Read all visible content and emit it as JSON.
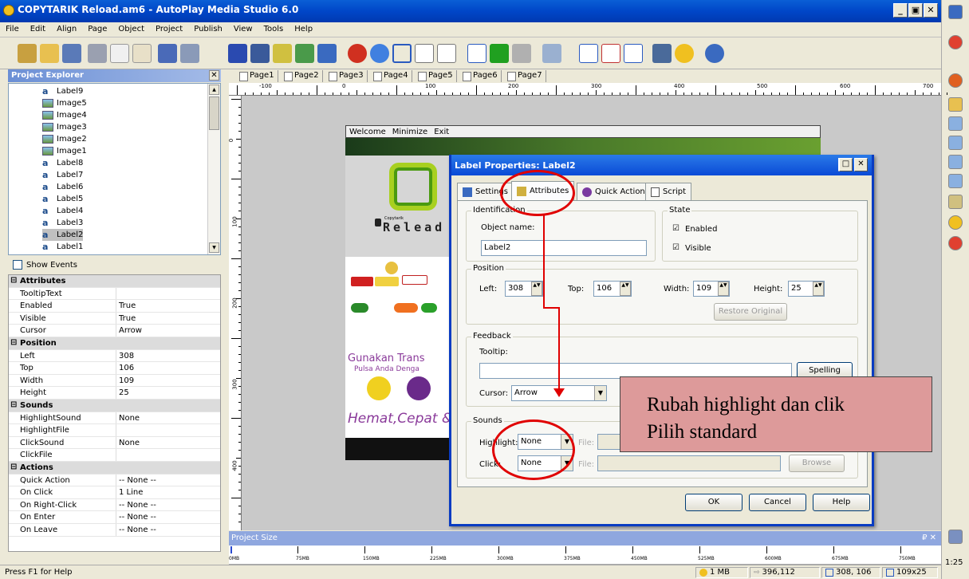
{
  "window": {
    "title": "COPYTARIK Reload.am6 - AutoPlay Media Studio 6.0",
    "min": "_",
    "max": "▣",
    "close": "✕"
  },
  "menu": [
    "File",
    "Edit",
    "Align",
    "Page",
    "Object",
    "Project",
    "Publish",
    "View",
    "Tools",
    "Help"
  ],
  "project_explorer": {
    "title": "Project Explorer",
    "close": "✕",
    "items": [
      {
        "label": "Label9",
        "type": "label"
      },
      {
        "label": "Image5",
        "type": "image"
      },
      {
        "label": "Image4",
        "type": "image"
      },
      {
        "label": "Image3",
        "type": "image"
      },
      {
        "label": "Image2",
        "type": "image"
      },
      {
        "label": "Image1",
        "type": "image"
      },
      {
        "label": "Label8",
        "type": "label"
      },
      {
        "label": "Label7",
        "type": "label"
      },
      {
        "label": "Label6",
        "type": "label"
      },
      {
        "label": "Label5",
        "type": "label"
      },
      {
        "label": "Label4",
        "type": "label"
      },
      {
        "label": "Label3",
        "type": "label"
      },
      {
        "label": "Label2",
        "type": "label",
        "selected": true
      },
      {
        "label": "Label1",
        "type": "label"
      }
    ],
    "show_events": "Show Events"
  },
  "properties": [
    {
      "section": "Attributes"
    },
    {
      "key": "TooltipText",
      "value": ""
    },
    {
      "key": "Enabled",
      "value": "True"
    },
    {
      "key": "Visible",
      "value": "True"
    },
    {
      "key": "Cursor",
      "value": "Arrow"
    },
    {
      "section": "Position"
    },
    {
      "key": "Left",
      "value": "308"
    },
    {
      "key": "Top",
      "value": "106"
    },
    {
      "key": "Width",
      "value": "109"
    },
    {
      "key": "Height",
      "value": "25"
    },
    {
      "section": "Sounds"
    },
    {
      "key": "HighlightSound",
      "value": "None"
    },
    {
      "key": "HighlightFile",
      "value": ""
    },
    {
      "key": "ClickSound",
      "value": "None"
    },
    {
      "key": "ClickFile",
      "value": ""
    },
    {
      "section": "Actions"
    },
    {
      "key": "Quick Action",
      "value": "-- None --"
    },
    {
      "key": "On Click",
      "value": "1 Line"
    },
    {
      "key": "On Right-Click",
      "value": "-- None --"
    },
    {
      "key": "On Enter",
      "value": "-- None --"
    },
    {
      "key": "On Leave",
      "value": "-- None --"
    }
  ],
  "page_tabs": [
    "Page1",
    "Page2",
    "Page3",
    "Page4",
    "Page5",
    "Page6",
    "Page7"
  ],
  "hruler": [
    "-100",
    "0",
    "100",
    "200",
    "300",
    "400",
    "500",
    "600",
    "700"
  ],
  "vruler": [
    "0",
    "100",
    "200",
    "300",
    "400",
    "500"
  ],
  "page_content": {
    "menu": [
      "Welcome",
      "Minimize",
      "Exit"
    ],
    "reload_small": "Copytarik",
    "reload": "Relead",
    "gunakan": "Gunakan Trans",
    "pulsa": "Pulsa Anda Denga",
    "hemat": "Hemat,Cepat & "
  },
  "dialog": {
    "title": "Label Properties: Label2",
    "min": "_",
    "max": "□",
    "close": "✕",
    "tabs": [
      "Settings",
      "Attributes",
      "Quick Action",
      "Script"
    ],
    "identification": {
      "group": "Identification",
      "object_name_label": "Object name:",
      "object_name": "Label2"
    },
    "state": {
      "group": "State",
      "enabled": "Enabled",
      "visible": "Visible",
      "check": "☑"
    },
    "position": {
      "group": "Position",
      "left_label": "Left:",
      "left": "308",
      "top_label": "Top:",
      "top": "106",
      "width_label": "Width:",
      "width": "109",
      "height_label": "Height:",
      "height": "25",
      "restore": "Restore Original"
    },
    "feedback": {
      "group": "Feedback",
      "tooltip_label": "Tooltip:",
      "tooltip": "",
      "spelling": "Spelling",
      "cursor_label": "Cursor:",
      "cursor": "Arrow"
    },
    "sounds": {
      "group": "Sounds",
      "highlight_label": "Highlight:",
      "highlight": "None",
      "click_label": "Click:",
      "click": "None",
      "file_label": "File:",
      "browse": "Browse"
    },
    "ok": "OK",
    "cancel": "Cancel",
    "help": "Help"
  },
  "callout": {
    "line1": "Rubah highlight dan clik",
    "line2": "Pilih standard"
  },
  "project_size": {
    "title": "Project Size",
    "pin": "₽ ✕",
    "labels": [
      "0MB",
      "75MB",
      "150MB",
      "225MB",
      "300MB",
      "375MB",
      "450MB",
      "525MB",
      "600MB",
      "675MB",
      "750MB"
    ]
  },
  "status": {
    "help": "Press F1 for Help",
    "size": "1 MB",
    "cursor": "396,112",
    "position": "308, 106",
    "dims": "109x25",
    "clock": "1:25"
  }
}
